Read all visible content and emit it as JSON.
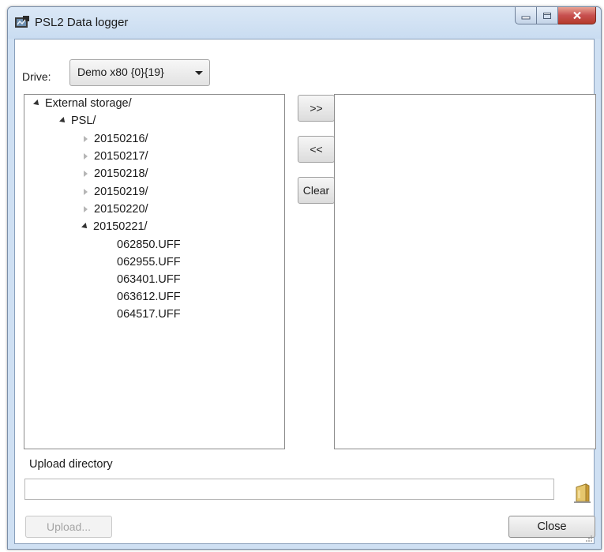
{
  "window": {
    "title": "PSL2 Data logger"
  },
  "drive": {
    "label": "Drive:",
    "selected": "Demo x80 {0}{19}"
  },
  "tree": [
    {
      "label": "External storage/",
      "state": "expanded",
      "level": 0
    },
    {
      "label": "PSL/",
      "state": "expanded",
      "level": 1
    },
    {
      "label": "20150216/",
      "state": "collapsed",
      "level": 2
    },
    {
      "label": "20150217/",
      "state": "collapsed",
      "level": 2
    },
    {
      "label": "20150218/",
      "state": "collapsed",
      "level": 2
    },
    {
      "label": "20150219/",
      "state": "collapsed",
      "level": 2
    },
    {
      "label": "20150220/",
      "state": "collapsed",
      "level": 2
    },
    {
      "label": "20150221/",
      "state": "expanded",
      "level": 2
    },
    {
      "label": "062850.UFF",
      "state": "leaf",
      "level": 3
    },
    {
      "label": "062955.UFF",
      "state": "leaf",
      "level": 3
    },
    {
      "label": "063401.UFF",
      "state": "leaf",
      "level": 3
    },
    {
      "label": "063612.UFF",
      "state": "leaf",
      "level": 3
    },
    {
      "label": "064517.UFF",
      "state": "leaf",
      "level": 3
    }
  ],
  "transfer": {
    "add_label": ">>",
    "remove_label": "<<",
    "clear_label": "Clear"
  },
  "upload_dir": {
    "label": "Upload directory",
    "value": ""
  },
  "buttons": {
    "upload_label": "Upload...",
    "close_label": "Close"
  },
  "colors": {
    "title_bar": "#cfe0f3",
    "close_caption": "#c75050",
    "disabled_text": "#a5a5a5"
  }
}
